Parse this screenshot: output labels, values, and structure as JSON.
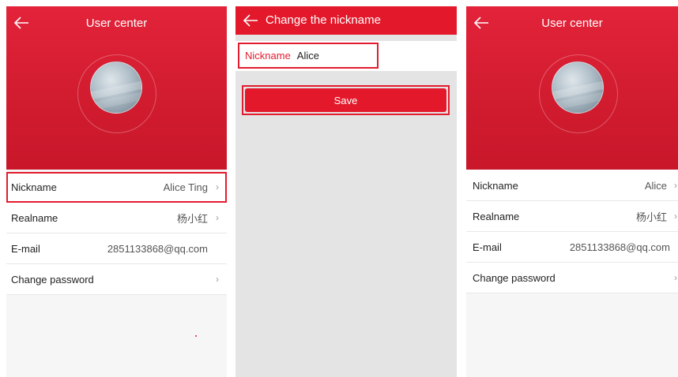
{
  "screen1": {
    "title": "User center",
    "rows": [
      {
        "label": "Nickname",
        "value": "Alice Ting",
        "chevron": "›"
      },
      {
        "label": "Realname",
        "value": "杨小红",
        "chevron": "›"
      },
      {
        "label": "E-mail",
        "value": "2851133868@qq.com",
        "chevron": ""
      },
      {
        "label": "Change password",
        "value": "",
        "chevron": "›"
      }
    ]
  },
  "screen2": {
    "title": "Change the nickname",
    "nickname_label": "Nickname",
    "nickname_value": "Alice",
    "save_label": "Save"
  },
  "screen3": {
    "title": "User center",
    "rows": [
      {
        "label": "Nickname",
        "value": "Alice",
        "chevron": "›"
      },
      {
        "label": "Realname",
        "value": "杨小红",
        "chevron": "›"
      },
      {
        "label": "E-mail",
        "value": "2851133868@qq.com",
        "chevron": ""
      },
      {
        "label": "Change password",
        "value": "",
        "chevron": "›"
      }
    ]
  },
  "colors": {
    "brand_red": "#e3192b",
    "highlight_border": "#e21c2e"
  },
  "icons": [
    "back-arrow-icon",
    "chevron-right-icon",
    "avatar-image"
  ]
}
